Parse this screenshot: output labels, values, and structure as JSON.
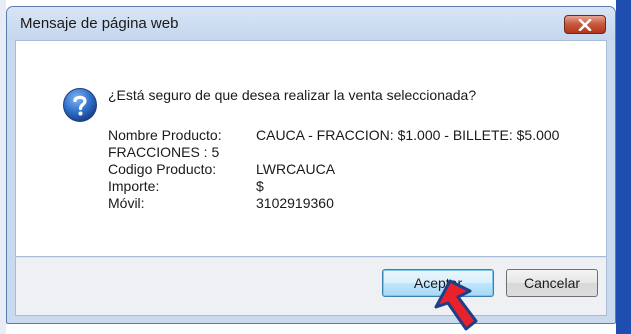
{
  "dialog": {
    "title": "Mensaje de página web",
    "message": "¿Está seguro de que desea realizar la venta seleccionada?",
    "rows": [
      {
        "label": "Nombre Producto:",
        "value": "CAUCA - FRACCION: $1.000 - BILLETE:  $5.000"
      },
      {
        "label": "FRACCIONES : 5",
        "value": ""
      },
      {
        "label": "Codigo Producto:",
        "value": "LWRCAUCA"
      },
      {
        "label": "Importe:",
        "value": "$"
      },
      {
        "label": "Móvil:",
        "value": "3102919360"
      }
    ],
    "buttons": {
      "accept": "Aceptar",
      "cancel": "Cancelar"
    },
    "icons": {
      "message": "question-icon",
      "close": "close-icon"
    }
  },
  "colors": {
    "titlebar": "#c9d9ee",
    "close": "#c95a41",
    "page_edge": "#1e4fb0",
    "cursor": "#e8212b"
  }
}
